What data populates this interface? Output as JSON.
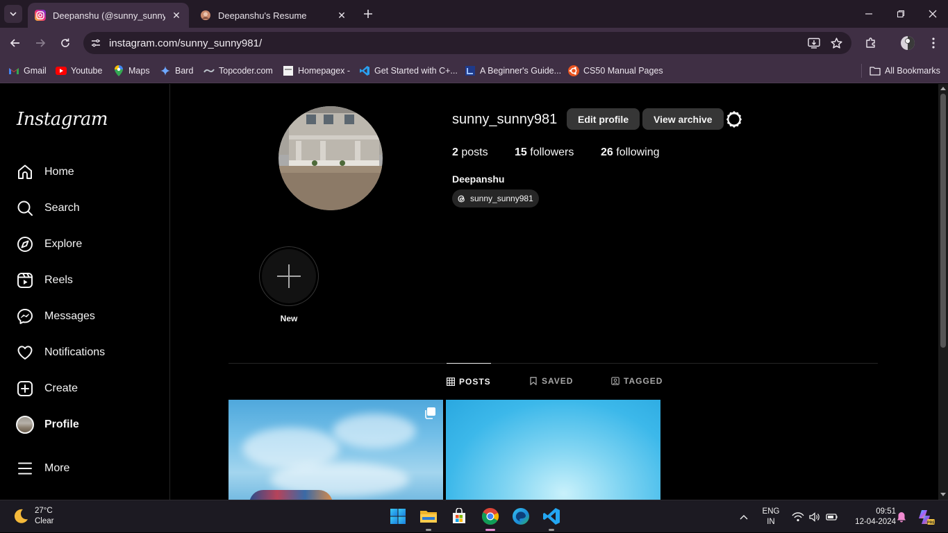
{
  "browser": {
    "tabs": [
      {
        "title": "Deepanshu (@sunny_sunny981)",
        "active": true
      },
      {
        "title": "Deepanshu's Resume",
        "active": false
      }
    ],
    "url": "instagram.com/sunny_sunny981/",
    "bookmarks": [
      {
        "label": "Gmail",
        "icon": "gmail-icon"
      },
      {
        "label": "Youtube",
        "icon": "youtube-icon"
      },
      {
        "label": "Maps",
        "icon": "maps-icon"
      },
      {
        "label": "Bard",
        "icon": "bard-icon"
      },
      {
        "label": "Topcoder.com",
        "icon": "topcoder-icon"
      },
      {
        "label": "Homepagex -",
        "icon": "page-icon"
      },
      {
        "label": "Get Started with C+...",
        "icon": "vscode-icon"
      },
      {
        "label": "A Beginner's Guide...",
        "icon": "guide-icon"
      },
      {
        "label": "CS50 Manual Pages",
        "icon": "ubuntu-icon"
      }
    ],
    "all_bookmarks": "All Bookmarks"
  },
  "instagram": {
    "logo": "Instagram",
    "nav": [
      {
        "label": "Home",
        "icon": "home-icon"
      },
      {
        "label": "Search",
        "icon": "search-icon"
      },
      {
        "label": "Explore",
        "icon": "compass-icon"
      },
      {
        "label": "Reels",
        "icon": "reels-icon"
      },
      {
        "label": "Messages",
        "icon": "messenger-icon"
      },
      {
        "label": "Notifications",
        "icon": "heart-icon"
      },
      {
        "label": "Create",
        "icon": "plus-square-icon"
      },
      {
        "label": "Profile",
        "icon": "avatar"
      },
      {
        "label": "More",
        "icon": "menu-icon"
      }
    ],
    "profile": {
      "username": "sunny_sunny981",
      "edit_profile": "Edit profile",
      "view_archive": "View archive",
      "posts_count": "2",
      "posts_label": "posts",
      "followers_count": "15",
      "followers_label": "followers",
      "following_count": "26",
      "following_label": "following",
      "full_name": "Deepanshu",
      "threads_handle": "sunny_sunny981"
    },
    "highlight_new": "New",
    "profile_tabs": [
      {
        "label": "POSTS",
        "active": true
      },
      {
        "label": "SAVED",
        "active": false
      },
      {
        "label": "TAGGED",
        "active": false
      }
    ]
  },
  "taskbar": {
    "weather_temp": "27°C",
    "weather_desc": "Clear",
    "lang_1": "ENG",
    "lang_2": "IN",
    "time": "09:51",
    "date": "12-04-2024"
  }
}
